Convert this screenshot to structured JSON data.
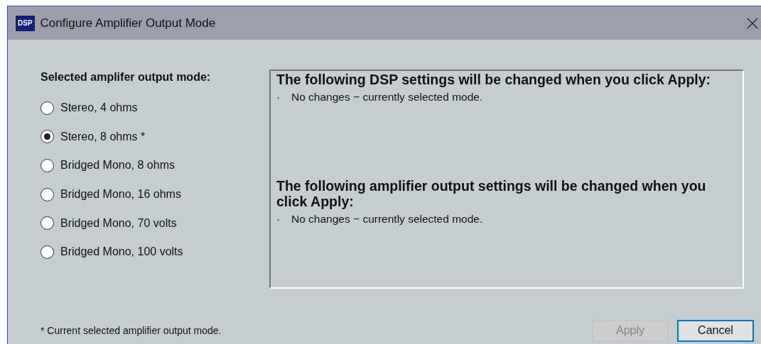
{
  "window": {
    "logo": "DSP",
    "title": "Configure Amplifier Output Mode"
  },
  "mode_group": {
    "heading": "Selected amplifer output mode:",
    "options": [
      {
        "label": "Stereo, 4 ohms",
        "selected": false
      },
      {
        "label": "Stereo, 8 ohms *",
        "selected": true
      },
      {
        "label": "Bridged Mono, 8 ohms",
        "selected": false
      },
      {
        "label": "Bridged Mono, 16 ohms",
        "selected": false
      },
      {
        "label": "Bridged Mono, 70 volts",
        "selected": false
      },
      {
        "label": "Bridged Mono, 100 volts",
        "selected": false
      }
    ]
  },
  "changes_panel": {
    "sections": [
      {
        "heading": "The following DSP settings will be changed when you click Apply:",
        "items": [
          {
            "bullet": "·",
            "text": "No changes − currently selected mode."
          }
        ]
      },
      {
        "heading": "The following amplifier output settings will be changed when you click Apply:",
        "items": [
          {
            "bullet": "·",
            "text": "No changes − currently selected mode."
          }
        ]
      }
    ]
  },
  "footnote": "* Current selected amplifier output mode.",
  "buttons": [
    {
      "label": "Apply",
      "disabled": true,
      "default": false
    },
    {
      "label": "Cancel",
      "disabled": false,
      "default": true
    }
  ]
}
